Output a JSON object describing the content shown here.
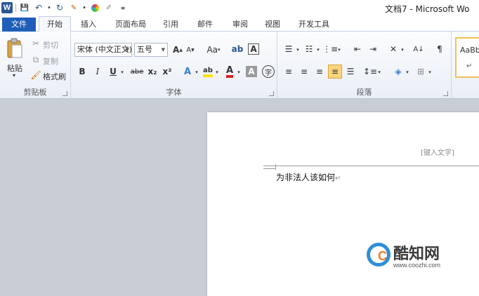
{
  "window": {
    "title": "文档7 - Microsoft Wo"
  },
  "tabs": [
    "文件",
    "开始",
    "插入",
    "页面布局",
    "引用",
    "邮件",
    "审阅",
    "视图",
    "开发工具"
  ],
  "clipboard": {
    "paste": "粘贴",
    "cut": "剪切",
    "copy": "复制",
    "format_painter": "格式刷",
    "label": "剪贴板"
  },
  "font": {
    "name": "宋体 (中文正文)",
    "size": "五号",
    "label": "字体",
    "bold": "B",
    "italic": "I",
    "underline": "U",
    "strike": "abe",
    "subscript": "x₂",
    "superscript": "x²",
    "case": "Aa"
  },
  "paragraph": {
    "label": "段落"
  },
  "styles": {
    "preview": "AaBb"
  },
  "document": {
    "header_hint": "[键入文字]",
    "body": "为非法人该如何"
  },
  "watermark": {
    "title": "酷知网",
    "url": "www.coozhi.com",
    "mark": "C"
  },
  "colors": {
    "file_tab": "#1e5eb8",
    "highlight": "#ffe000",
    "font_color": "#e02020",
    "accent": "#f0c055"
  }
}
